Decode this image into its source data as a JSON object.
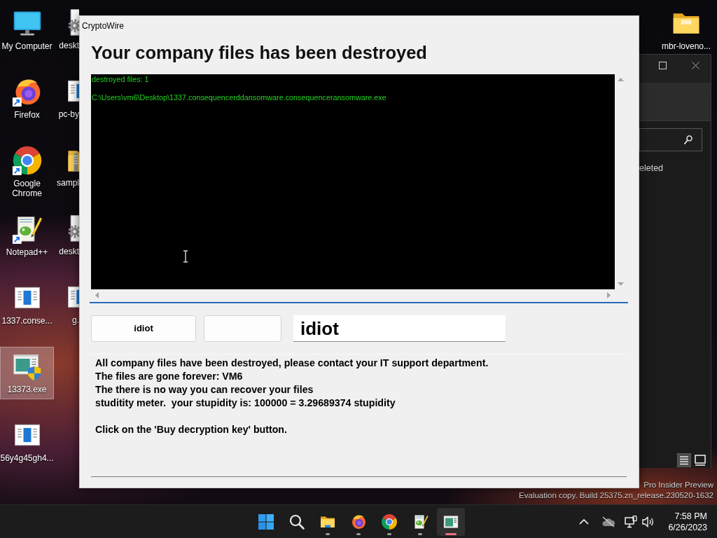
{
  "desktop": {
    "columns": [
      {
        "items": [
          {
            "label": "My Computer",
            "kind": "computer",
            "selected": false
          },
          {
            "label": "Firefox",
            "kind": "firefox",
            "selected": false
          },
          {
            "label": "Google Chrome",
            "kind": "chrome",
            "selected": false
          },
          {
            "label": "Notepad++",
            "kind": "notepad",
            "selected": false
          },
          {
            "label": "1337.conse...",
            "kind": "program",
            "selected": false
          },
          {
            "label": "13373.exe",
            "kind": "setup",
            "selected": true
          },
          {
            "label": "56y4g45gh4...",
            "kind": "program",
            "selected": false
          }
        ]
      },
      {
        "items": [
          {
            "label": "deskt",
            "kind": "config",
            "selected": false
          },
          {
            "label": "pc-by",
            "kind": "program",
            "selected": false
          },
          {
            "label": "sampl",
            "kind": "archive",
            "selected": false
          },
          {
            "label": "deskt",
            "kind": "config",
            "selected": false
          },
          {
            "label": "g.",
            "kind": "program",
            "selected": false
          }
        ]
      }
    ],
    "top_right_items": [
      {
        "label": "mbr-loveno...",
        "kind": "folder",
        "selected": false
      }
    ],
    "build_info": [
      "Pro Insider Preview",
      "Evaluation copy. Build 25375.zn_release.230520-1632"
    ]
  },
  "explorer_window": {
    "label": "eleted",
    "view_buttons": [
      {
        "kind": "details",
        "selected": true
      },
      {
        "kind": "thumbnails",
        "selected": false
      }
    ]
  },
  "app_window": {
    "title": "CryptoWire",
    "heading": "Your company files has been destroyed",
    "log_lines": [
      "destroyed files: 1",
      "C:\\Users\\vm6\\Desktop\\1337.consequencerddansomware.consequenceransomware.exe"
    ],
    "buttons": [
      {
        "kind": "text",
        "label": "idiot"
      },
      {
        "kind": "blank"
      }
    ],
    "text_field": {
      "value": "idiot"
    },
    "message": {
      "paragraphs": [
        {
          "lines": [
            "All company files have been destroyed, please contact your IT support department.",
            "The files are gone forever: VM6",
            "The there is no way you can recover your files",
            "studitity meter.  your stupidity is: 100000 = 3.29689374 stupidity"
          ]
        },
        {
          "lines": [
            "Click on the 'Buy decryption key' button."
          ]
        }
      ]
    }
  },
  "taskbar": {
    "items": [
      {
        "kind": "start",
        "running": false,
        "selected": false
      },
      {
        "kind": "search",
        "running": false,
        "selected": false
      },
      {
        "kind": "explorer",
        "running": true,
        "selected": false
      },
      {
        "kind": "firefox",
        "running": true,
        "selected": false
      },
      {
        "kind": "chrome",
        "running": true,
        "selected": false
      },
      {
        "kind": "notepad",
        "running": true,
        "selected": false
      },
      {
        "kind": "app",
        "running": true,
        "selected": true
      }
    ],
    "clock": {
      "time": "7:58 PM",
      "date": "6/26/2023"
    }
  }
}
